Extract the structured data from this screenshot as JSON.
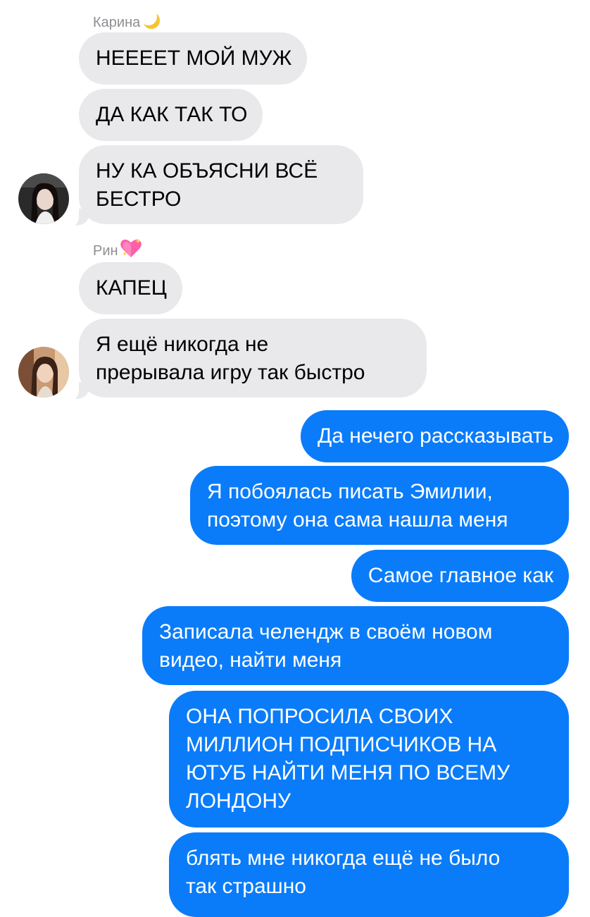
{
  "senders": {
    "karina": "Карина",
    "rin": "Рин"
  },
  "messages_karina": [
    {
      "lines": [
        "НЕЕЕЕТ МОЙ МУЖ"
      ]
    },
    {
      "lines": [
        "ДА КАК ТАК ТО"
      ]
    },
    {
      "lines": [
        "НУ КА ОБЪЯСНИ ВСЁ",
        "БЕСТРО"
      ]
    }
  ],
  "messages_rin": [
    {
      "lines": [
        "КАПЕЦ"
      ]
    },
    {
      "lines": [
        "Я ещё никогда не",
        "прерывала игру так быстро"
      ]
    }
  ],
  "messages_me": [
    {
      "lines": [
        "Да нечего рассказывать"
      ]
    },
    {
      "lines": [
        "Я побоялась писать Эмилии,",
        "поэтому она сама нашла меня"
      ]
    },
    {
      "lines": [
        "Самое главное как"
      ]
    },
    {
      "lines": [
        "Записала челендж в своём новом",
        "видео, найти меня"
      ]
    },
    {
      "lines": [
        "ОНА ПОПРОСИЛА СВОИХ",
        "МИЛЛИОН ПОДПИСЧИКОВ НА",
        "ЮТУБ НАЙТИ МЕНЯ ПО ВСЕМУ",
        "ЛОНДОНУ"
      ]
    },
    {
      "lines": [
        "блять мне никогда ещё не было",
        "так страшно"
      ]
    }
  ],
  "icons": {
    "karina_badge": "crescent-moon-emoji",
    "rin_badge": "sparkling-heart-emoji"
  },
  "colors": {
    "incoming_bubble": "#e9e9eb",
    "outgoing_bubble": "#0a7cfa",
    "sender_name": "#8e8e93"
  }
}
